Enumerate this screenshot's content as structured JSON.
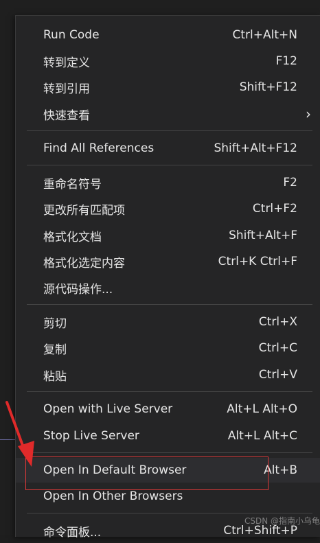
{
  "menu": {
    "items": [
      {
        "label": "Run Code",
        "key": "Ctrl+Alt+N"
      },
      {
        "label": "转到定义",
        "key": "F12"
      },
      {
        "label": "转到引用",
        "key": "Shift+F12"
      },
      {
        "label": "快速查看",
        "key": ""
      },
      {
        "label": "Find All References",
        "key": "Shift+Alt+F12"
      },
      {
        "label": "重命名符号",
        "key": "F2"
      },
      {
        "label": "更改所有匹配项",
        "key": "Ctrl+F2"
      },
      {
        "label": "格式化文档",
        "key": "Shift+Alt+F"
      },
      {
        "label": "格式化选定内容",
        "key": "Ctrl+K Ctrl+F"
      },
      {
        "label": "源代码操作...",
        "key": ""
      },
      {
        "label": "剪切",
        "key": "Ctrl+X"
      },
      {
        "label": "复制",
        "key": "Ctrl+C"
      },
      {
        "label": "粘贴",
        "key": "Ctrl+V"
      },
      {
        "label": "Open with Live Server",
        "key": "Alt+L Alt+O"
      },
      {
        "label": "Stop Live Server",
        "key": "Alt+L Alt+C"
      },
      {
        "label": "Open In Default Browser",
        "key": "Alt+B"
      },
      {
        "label": "Open In Other Browsers",
        "key": ""
      },
      {
        "label": "命令面板...",
        "key": "Ctrl+Shift+P"
      }
    ],
    "submenu_icon": "chevron-right-icon"
  },
  "watermark": "CSDN @指南小乌龟",
  "colors": {
    "menu_bg": "#252526",
    "text": "#e6e6e6",
    "highlight": "#e03a3a"
  }
}
